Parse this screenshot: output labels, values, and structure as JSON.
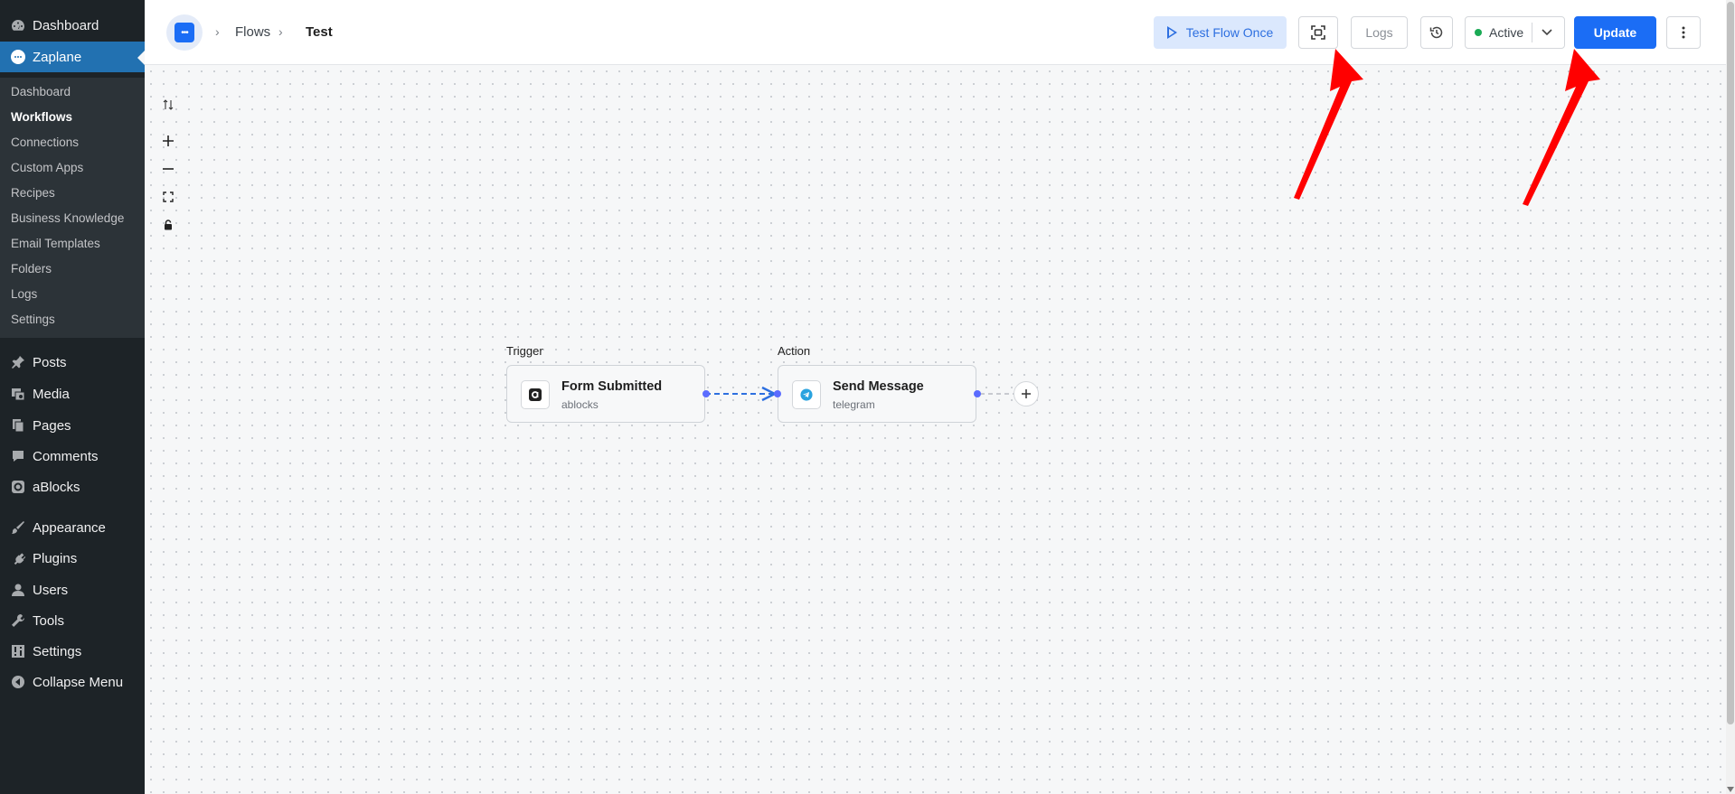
{
  "sidebar": {
    "top_item": "Dashboard",
    "current_plugin": "Zaplane",
    "submenu": [
      "Dashboard",
      "Workflows",
      "Connections",
      "Custom Apps",
      "Recipes",
      "Business Knowledge",
      "Email Templates",
      "Folders",
      "Logs",
      "Settings"
    ],
    "active_submenu": "Workflows",
    "menu": {
      "posts": "Posts",
      "media": "Media",
      "pages": "Pages",
      "comments": "Comments",
      "ablocks": "aBlocks",
      "appearance": "Appearance",
      "plugins": "Plugins",
      "users": "Users",
      "tools": "Tools",
      "settings": "Settings",
      "collapse": "Collapse Menu"
    }
  },
  "header": {
    "breadcrumb": [
      "Flows",
      "Test"
    ],
    "test_button": "Test Flow Once",
    "logs_button": "Logs",
    "status": "Active",
    "update_button": "Update"
  },
  "flow": {
    "trigger": {
      "label": "Trigger",
      "title": "Form Submitted",
      "app": "ablocks",
      "icon": "ablocks-icon"
    },
    "action": {
      "label": "Action",
      "title": "Send Message",
      "app": "telegram",
      "icon": "telegram-icon"
    }
  },
  "colors": {
    "sidebar_bg": "#1d2327",
    "accent": "#1b6df5",
    "wp_blue": "#2271b1",
    "active_green": "#1aaa55",
    "annotation_red": "#ff0000"
  }
}
